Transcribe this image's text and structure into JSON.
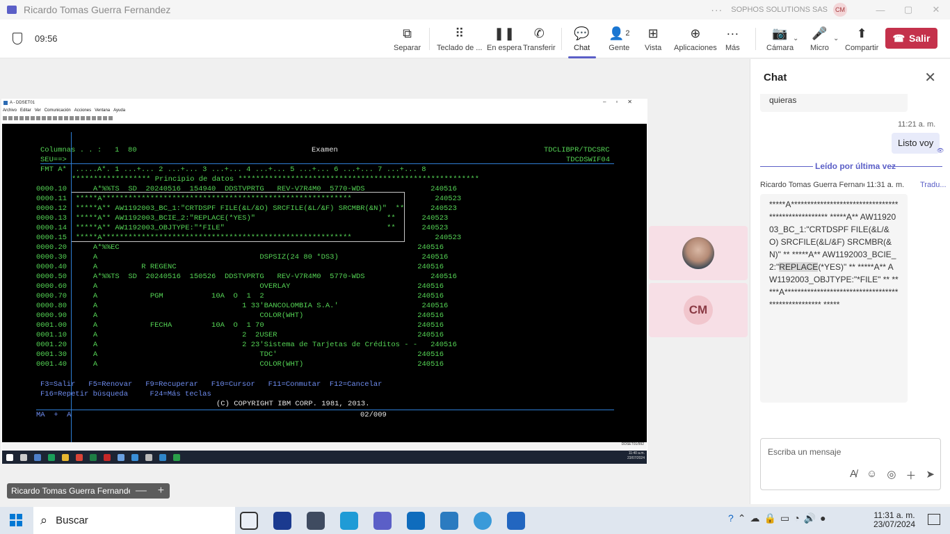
{
  "window": {
    "title": "Ricardo Tomas Guerra Fernandez",
    "org": "SOPHOS SOLUTIONS SAS",
    "org_avatar": "CM",
    "more": "···"
  },
  "meeting": {
    "timer": "09:56",
    "buttons": {
      "separar": "Separar",
      "teclado": "Teclado de ...",
      "espera": "En espera",
      "transferir": "Transferir",
      "chat": "Chat",
      "gente": "Gente",
      "gente_count": "2",
      "vista": "Vista",
      "aplicaciones": "Aplicaciones",
      "mas": "Más",
      "camara": "Cámara",
      "micro": "Micro",
      "compartir": "Compartir",
      "salir": "Salir"
    }
  },
  "emulator": {
    "title": "A - DDSET01",
    "menu": [
      "Archivo",
      "Editar",
      "Ver",
      "Comunicación",
      "Acciones",
      "Ventana",
      "Ayuda"
    ],
    "screen": {
      "header_left": "Columnas . . :   1  80",
      "header_center": "Examen",
      "header_right": "TDCLIBPR/TDCSRC",
      "seu": "SEU==>",
      "member": "TDCDSWIF04",
      "ruler": "FMT A*  .....A*. 1 ...+... 2 ...+... 3 ...+... 4 ...+... 5 ...+... 6 ...+... 7 ...+... 8",
      "data_start": "****************** Principio de datos *******************************************************",
      "lines": [
        "0000.10      A*%%TS  SD  20240516  154940  DDSTVPRTG   REV-V7R4M0  5770-WDS               240516",
        "0000.11  *****A*********************************************************                   240523",
        "0000.12  *****A** AW1192003_BC_1:\"CRTDSPF FILE(&L/&O) SRCFILE(&L/&F) SRCMBR(&N)\"  **      240523",
        "0000.13  *****A** AW1192003_BCIE_2:\"REPLACE(*YES)\"                              **      240523",
        "0000.14  *****A** AW1192003_OBJTYPE:\"*FILE\"                                     **      240523",
        "0000.15  *****A*********************************************************                   240523",
        "0000.20      A*%%EC                                                                    240516",
        "0000.30      A                                     DSPSIZ(24 80 *DS3)                   240516",
        "0000.40      A          R REGENC                                                       240516",
        "0000.50      A*%%TS  SD  20240516  150526  DDSTVPRTG   REV-V7R4M0  5770-WDS               240516",
        "0000.60      A                                     OVERLAY                             240516",
        "0000.70      A            PGM           10A  O  1  2                                   240516",
        "0000.80      A                                 1 33'BANCOLOMBIA S.A.'                   240516",
        "0000.90      A                                     COLOR(WHT)                          240516",
        "0001.00      A            FECHA         10A  O  1 70                                   240516",
        "0001.10      A                                 2  2USER                                240516",
        "0001.20      A                                 2 23'Sistema de Tarjetas de Créditos - -   240516",
        "0001.30      A                                     TDC'                                240516",
        "0001.40      A                                     COLOR(WHT)                          240516"
      ],
      "fkeys_1": "F3=Salir   F5=Renovar   F9=Recuperar   F10=Cursor   F11=Conmutar  F12=Cancelar",
      "fkeys_2": "F16=Repetir búsqueda     F24=Más teclas",
      "copyright": "(C) COPYRIGHT IBM CORP. 1981, 2013.",
      "status_left": "MA  +  A",
      "status_pos": "02/009"
    },
    "statusbar": "DDSET01/992",
    "clock_time": "11:40 a.m.",
    "clock_date": "23/07/2024"
  },
  "tiles": [
    {
      "name": "participant-photo"
    },
    {
      "initials": "CM"
    }
  ],
  "presenter_name": "Ricardo Tomas Guerra Fernandez",
  "zoom": {
    "minus": "—",
    "plus": "+"
  },
  "chat": {
    "title": "Chat",
    "prev_msg": "quieras",
    "my_time": "11:21 a. m.",
    "my_msg": "Listo voy",
    "divider": "Leído por última vez",
    "sender": "Ricardo Tomas Guerra Fernandez",
    "sender_time": "11:31 a. m.",
    "translate": "Tradu...",
    "msg_before": "*****A*************************************************** *****A** AW1192003_BC_1:\"CRTDSPF FILE(&L/&O) SRCFILE(&L/&F) SRCMBR(&N)\"  ** *****A** AW1192003_BCIE_2:\"",
    "msg_highlight": "REPLACE",
    "msg_after": "(*YES)\"                ** *****A** AW1192003_OBJTYPE:\"*FILE\"                    ** *****A*************************************************** *****",
    "compose_placeholder": "Escriba un mensaje"
  },
  "taskbar": {
    "search": "Buscar",
    "time": "11:31 a. m.",
    "date": "23/07/2024"
  }
}
